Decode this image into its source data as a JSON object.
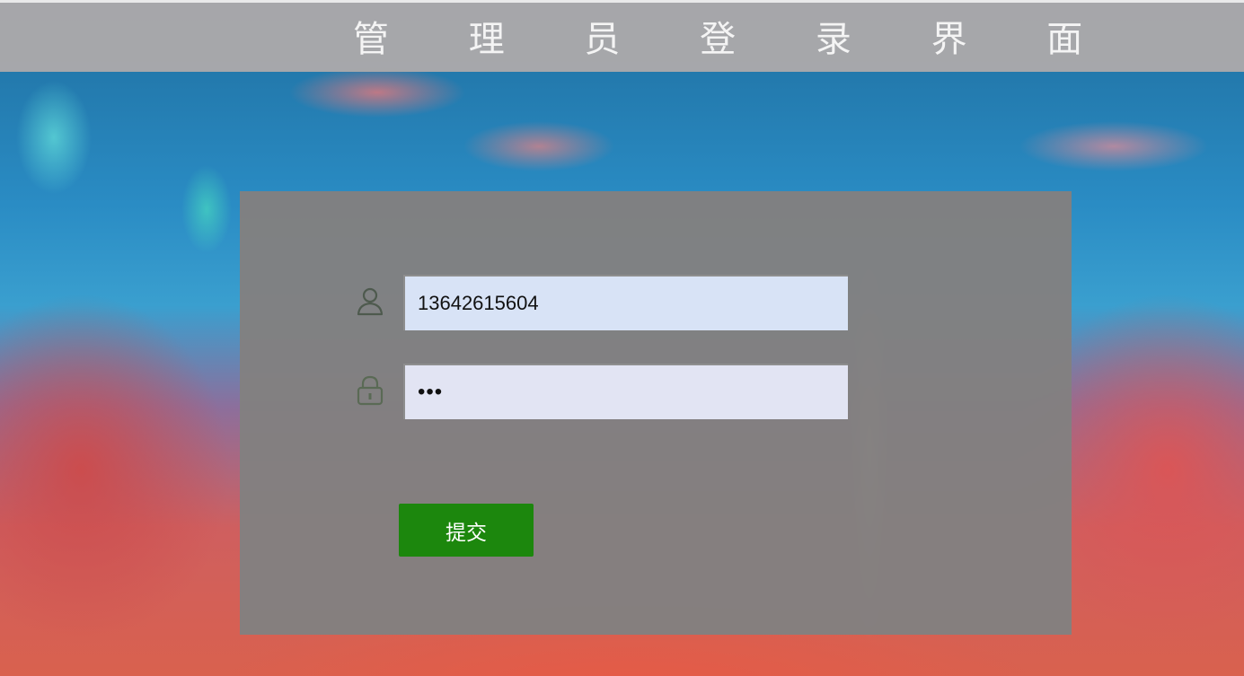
{
  "header": {
    "title": "管 理 员 登 录 界 面"
  },
  "form": {
    "username": {
      "icon": "user-icon",
      "value": "13642615604"
    },
    "password": {
      "icon": "lock-icon",
      "value": "•••"
    },
    "submit_label": "提交"
  },
  "colors": {
    "header_bg": "#aaa8aa",
    "panel_bg": "#828080",
    "username_field_bg": "#d8e3f6",
    "password_field_bg": "#e2e4f3",
    "submit_bg": "#1c870d"
  }
}
